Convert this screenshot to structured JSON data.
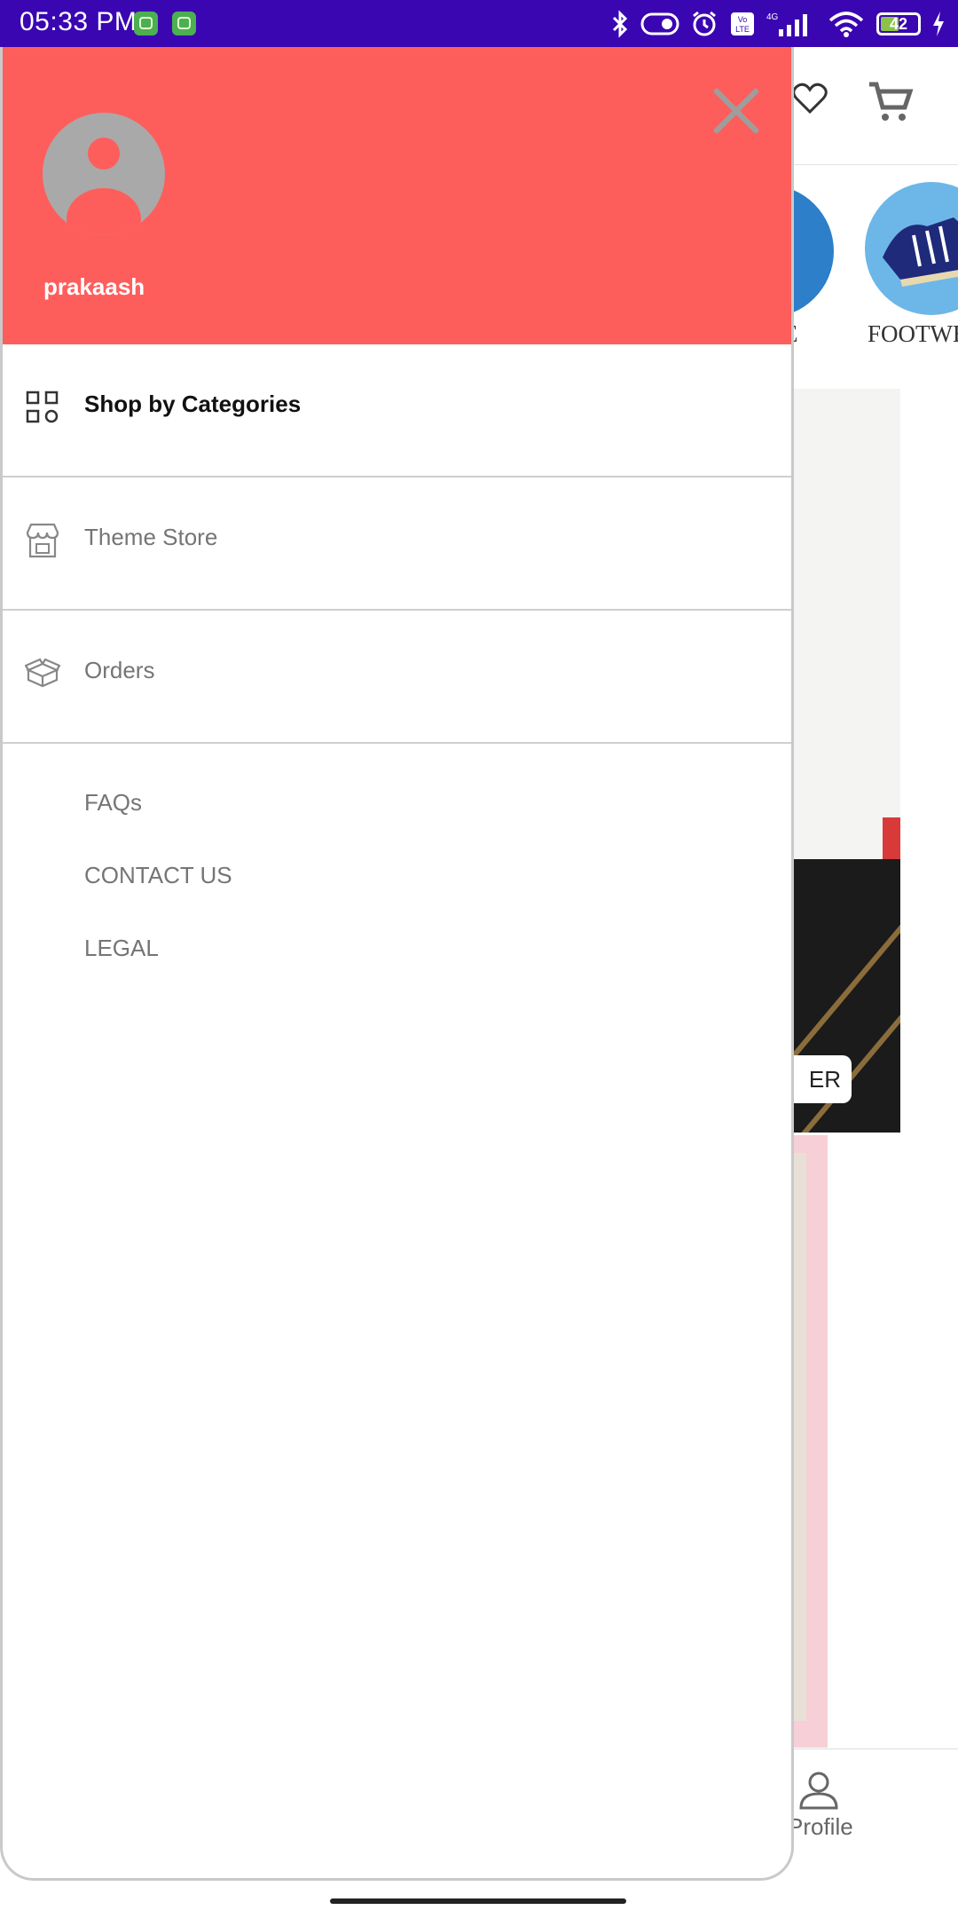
{
  "status_bar": {
    "time": "05:33 PM",
    "battery": "42",
    "icons": [
      "bluetooth-icon",
      "toggle-icon",
      "alarm-icon",
      "volte-icon",
      "signal-4g-icon",
      "wifi-icon",
      "battery-icon",
      "charging-icon"
    ]
  },
  "drawer": {
    "username": "prakaash",
    "menu": [
      {
        "label": "Shop by Categories",
        "icon": "grid-icon",
        "active": true
      },
      {
        "label": "Theme Store",
        "icon": "store-icon",
        "active": false
      },
      {
        "label": "Orders",
        "icon": "box-icon",
        "active": false
      }
    ],
    "links": [
      "FAQs",
      "CONTACT US",
      "LEGAL"
    ],
    "accent_color": "#fd5e5c"
  },
  "background": {
    "category_labels": [
      "E",
      "FOOTWE"
    ],
    "banner_button_text": "ER",
    "bottom_nav_label": "Profile"
  }
}
